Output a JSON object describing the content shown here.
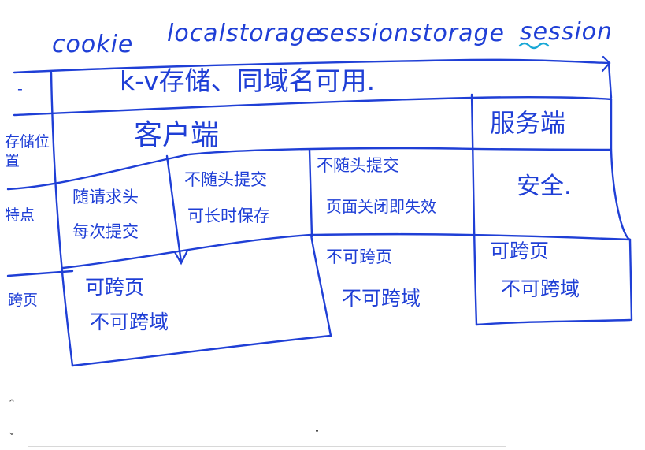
{
  "accent_color": "#1f3fd6",
  "underline_color": "#19a8d6",
  "headers": {
    "cookie": "cookie",
    "localstorage": "localstorage",
    "sessionstorage": "sessionstorage",
    "session": "session"
  },
  "row_labels": {
    "common": "-",
    "storage_location": "存储位置",
    "features": "特点",
    "cross_origin": "跨页"
  },
  "cells": {
    "common": "k-v存储、同域名可用.",
    "client": "客户端",
    "server": "服务端",
    "cookie_feature_line1": "随请求头",
    "cookie_feature_line2": "每次提交",
    "local_feature_line1": "不随头提交",
    "local_feature_line2": "可长时保存",
    "session_storage_feature_line1": "不随头提交",
    "session_storage_feature_line2": "页面关闭即失效",
    "session_feature": "安全.",
    "cookie_local_cross_line1": "可跨页",
    "cookie_local_cross_line2": "不可跨域",
    "session_storage_cross_line1": "不可跨页",
    "session_storage_cross_line2": "不可跨域",
    "session_cross_line1": "可跨页",
    "session_cross_line2": "不可跨域"
  },
  "nav": {
    "up_arrow": "⌃",
    "down_arrow": "⌄"
  }
}
